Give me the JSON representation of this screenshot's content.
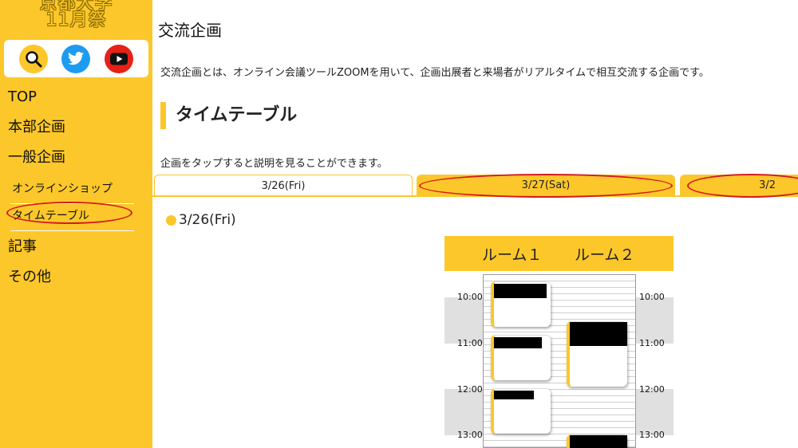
{
  "sidebar": {
    "logo_line1": "京都大学",
    "logo_line2": "11月祭",
    "social_icons": [
      "search-icon",
      "twitter-icon",
      "youtube-icon"
    ],
    "nav": [
      "TOP",
      "本部企画",
      "一般企画"
    ],
    "sub_nav": [
      "オンラインショップ",
      "タイムテーブル"
    ],
    "nav_after": [
      "記事",
      "その他"
    ]
  },
  "main": {
    "page_title": "交流企画",
    "intro": "交流企画とは、オンライン会議ツールZOOMを用いて、企画出展者と来場者がリアルタイムで相互交流する企画です。",
    "section_title": "タイムテーブル",
    "hint": "企画をタップすると説明を見ることができます。",
    "tabs": [
      "3/26(Fri)",
      "3/27(Sat)",
      "3/2"
    ],
    "date_heading": "3/26(Fri)"
  },
  "timetable": {
    "rooms": [
      "ルーム１",
      "ルーム２"
    ],
    "times": [
      "10:00",
      "11:00",
      "12:00",
      "13:00"
    ]
  },
  "colors": {
    "accent": "#fcc72a",
    "highlight_circle": "#d21c1c"
  }
}
